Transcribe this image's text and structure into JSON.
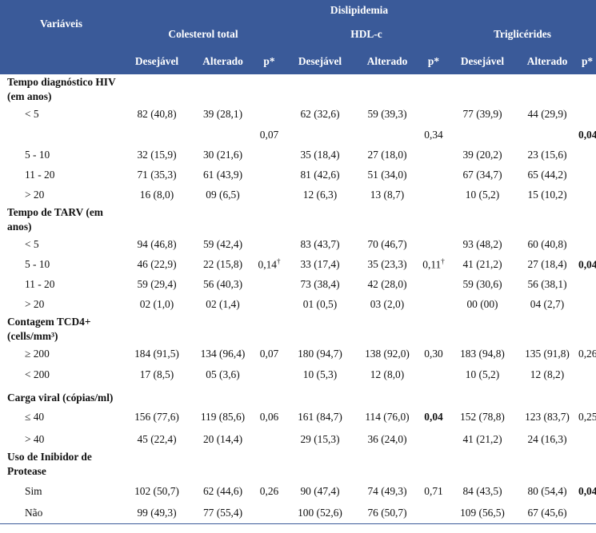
{
  "header": {
    "group_title": "Dislipidemia",
    "variables_label": "Variáveis",
    "groups": [
      "Colesterol total",
      "HDL-c",
      "Triglicérides"
    ],
    "subcols": [
      "Desejável",
      "Alterado",
      "p*"
    ]
  },
  "sections": [
    {
      "title": "Tempo diagnóstico HIV (em anos)",
      "rows": [
        {
          "label": "< 5",
          "v": [
            "82 (40,8)",
            "39 (28,1)",
            "",
            "62 (32,6)",
            "59 (39,3)",
            "",
            "77 (39,9)",
            "44 (29,9)",
            ""
          ]
        },
        {
          "label": "",
          "v": [
            "",
            "",
            "0,07",
            "",
            "",
            "0,34",
            "",
            "",
            "0,04"
          ]
        },
        {
          "label": "5 - 10",
          "v": [
            "32 (15,9)",
            "30 (21,6)",
            "",
            "35 (18,4)",
            "27 (18,0)",
            "",
            "39 (20,2)",
            "23 (15,6)",
            ""
          ]
        },
        {
          "label": "11 - 20",
          "v": [
            "71 (35,3)",
            "61 (43,9)",
            "",
            "81 (42,6)",
            "51 (34,0)",
            "",
            "67 (34,7)",
            "65 (44,2)",
            ""
          ]
        },
        {
          "label": "> 20",
          "v": [
            "16 (8,0)",
            "09 (6,5)",
            "",
            "12 (6,3)",
            "13 (8,7)",
            "",
            "10 (5,2)",
            "15 (10,2)",
            ""
          ]
        }
      ]
    },
    {
      "title": "Tempo de TARV (em anos)",
      "rows": [
        {
          "label": "< 5",
          "v": [
            "94 (46,8)",
            "59 (42,4)",
            "",
            "83 (43,7)",
            "70 (46,7)",
            "",
            "93 (48,2)",
            "60 (40,8)",
            ""
          ]
        },
        {
          "label": "5 - 10",
          "v": [
            "46 (22,9)",
            "22 (15,8)",
            "0,14",
            "33 (17,4)",
            "35 (23,3)",
            "0,11",
            "41 (21,2)",
            "27 (18,4)",
            "0,04"
          ]
        },
        {
          "label": "11 - 20",
          "v": [
            "59 (29,4)",
            "56 (40,3)",
            "",
            "73 (38,4)",
            "42 (28,0)",
            "",
            "59 (30,6)",
            "56 (38,1)",
            ""
          ]
        },
        {
          "label": "> 20",
          "v": [
            "02 (1,0)",
            "02 (1,4)",
            "",
            "01 (0,5)",
            "03 (2,0)",
            "",
            "00 (00)",
            "04 (2,7)",
            ""
          ]
        }
      ]
    },
    {
      "title": "Contagem TCD4+ (cells/mm³)",
      "rows": [
        {
          "label": "≥ 200",
          "v": [
            "184 (91,5)",
            "134 (96,4)",
            "0,07",
            "180 (94,7)",
            "138 (92,0)",
            "0,30",
            "183 (94,8)",
            "135 (91,8)",
            "0,26"
          ]
        },
        {
          "label": "< 200",
          "v": [
            "17 (8,5)",
            "05 (3,6)",
            "",
            "10 (5,3)",
            "12 (8,0)",
            "",
            "10 (5,2)",
            "12 (8,2)",
            ""
          ]
        }
      ]
    },
    {
      "title": "Carga viral (cópias/ml)",
      "rows": [
        {
          "label": "≤ 40",
          "v": [
            "156 (77,6)",
            "119 (85,6)",
            "0,06",
            "161 (84,7)",
            "114 (76,0)",
            "0,04",
            "152 (78,8)",
            "123 (83,7)",
            "0,25"
          ]
        },
        {
          "label": "> 40",
          "v": [
            "45 (22,4)",
            "20 (14,4)",
            "",
            "29 (15,3)",
            "36 (24,0)",
            "",
            "41 (21,2)",
            "24 (16,3)",
            ""
          ]
        }
      ]
    },
    {
      "title": "Uso de Inibidor de Protease",
      "rows": [
        {
          "label": "Sim",
          "v": [
            "102 (50,7)",
            "62 (44,6)",
            "0,26",
            "90 (47,4)",
            "74 (49,3)",
            "0,71",
            "84 (43,5)",
            "80 (54,4)",
            "0,04"
          ]
        },
        {
          "label": "Não",
          "v": [
            "99 (49,3)",
            "77 (55,4)",
            "",
            "100 (52,6)",
            "76 (50,7)",
            "",
            "109 (56,5)",
            "67 (45,6)",
            ""
          ]
        }
      ]
    }
  ],
  "dagger": "†"
}
